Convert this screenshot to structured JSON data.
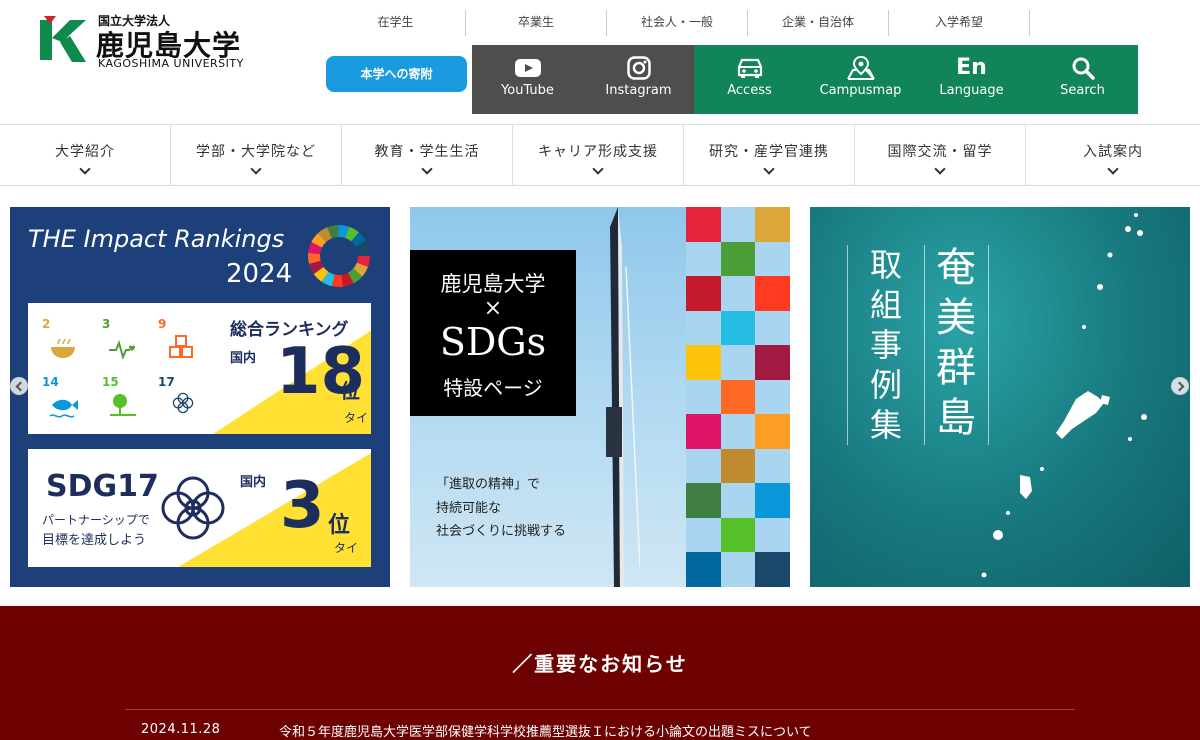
{
  "header": {
    "logo_sub": "国立大学法人",
    "logo_main": "鹿児島大学",
    "logo_en": "KAGOSHIMA UNIVERSITY",
    "audience_links": [
      "在学生",
      "卒業生",
      "社会人・一般",
      "企業・自治体",
      "入学希望"
    ],
    "donate_label": "本学への寄附",
    "quick_links": [
      {
        "label": "YouTube",
        "icon": "youtube-icon"
      },
      {
        "label": "Instagram",
        "icon": "instagram-icon"
      },
      {
        "label": "Access",
        "icon": "car-icon"
      },
      {
        "label": "Campusmap",
        "icon": "map-pin-icon"
      },
      {
        "label": "Language",
        "icon_text": "En"
      },
      {
        "label": "Search",
        "icon": "search-icon"
      }
    ]
  },
  "main_nav": [
    "大学紹介",
    "学部・大学院など",
    "教育・学生生活",
    "キャリア形成支援",
    "研究・産学官連携",
    "国際交流・留学",
    "入試案内"
  ],
  "banners": {
    "impact": {
      "title": "THE Impact Rankings",
      "year": "2024",
      "goals": [
        {
          "num": "2",
          "text": "飢餓を\nゼロに"
        },
        {
          "num": "3",
          "text": "すべての人に\n健康と福祉を"
        },
        {
          "num": "9",
          "text": "産業と技術革新の\n基盤をつくろう"
        },
        {
          "num": "14",
          "text": "海の豊かさを\n守ろう"
        },
        {
          "num": "15",
          "text": "陸の豊かさも\n守ろう"
        },
        {
          "num": "17",
          "text": "パートナーシップで\n目標を達成しよう"
        }
      ],
      "overall_heading": "総合ランキング",
      "overall_domestic": "国内",
      "overall_rank": "18",
      "overall_suffix": "位",
      "overall_tie": "タイ",
      "sdg17_heading": "SDG17",
      "sdg17_sub1": "パートナーシップで",
      "sdg17_sub2": "目標を達成しよう",
      "sdg17_domestic": "国内",
      "sdg17_rank": "3",
      "sdg17_suffix": "位",
      "sdg17_tie": "タイ"
    },
    "sdgs": {
      "line1": "鹿児島大学",
      "line2": "×",
      "line3": "SDGs",
      "line4": "特設ページ",
      "tagline": [
        "「進取の精神」で",
        "持続可能な",
        "社会づくりに挑戦する"
      ]
    },
    "amami": {
      "col_right": "奄美群島",
      "col_left": "取組事例集"
    }
  },
  "notice": {
    "heading": "／重要なお知らせ",
    "items": [
      {
        "date": "2024.11.28",
        "text": "令和５年度鹿児島大学医学部保健学科学校推薦型選抜Ｉにおける小論文の出題ミスについて"
      }
    ]
  },
  "colors": {
    "donate": "#1a9be0",
    "social_bg": "#4e4e4e",
    "green": "#11845a",
    "notice_bg": "#6d0000"
  }
}
